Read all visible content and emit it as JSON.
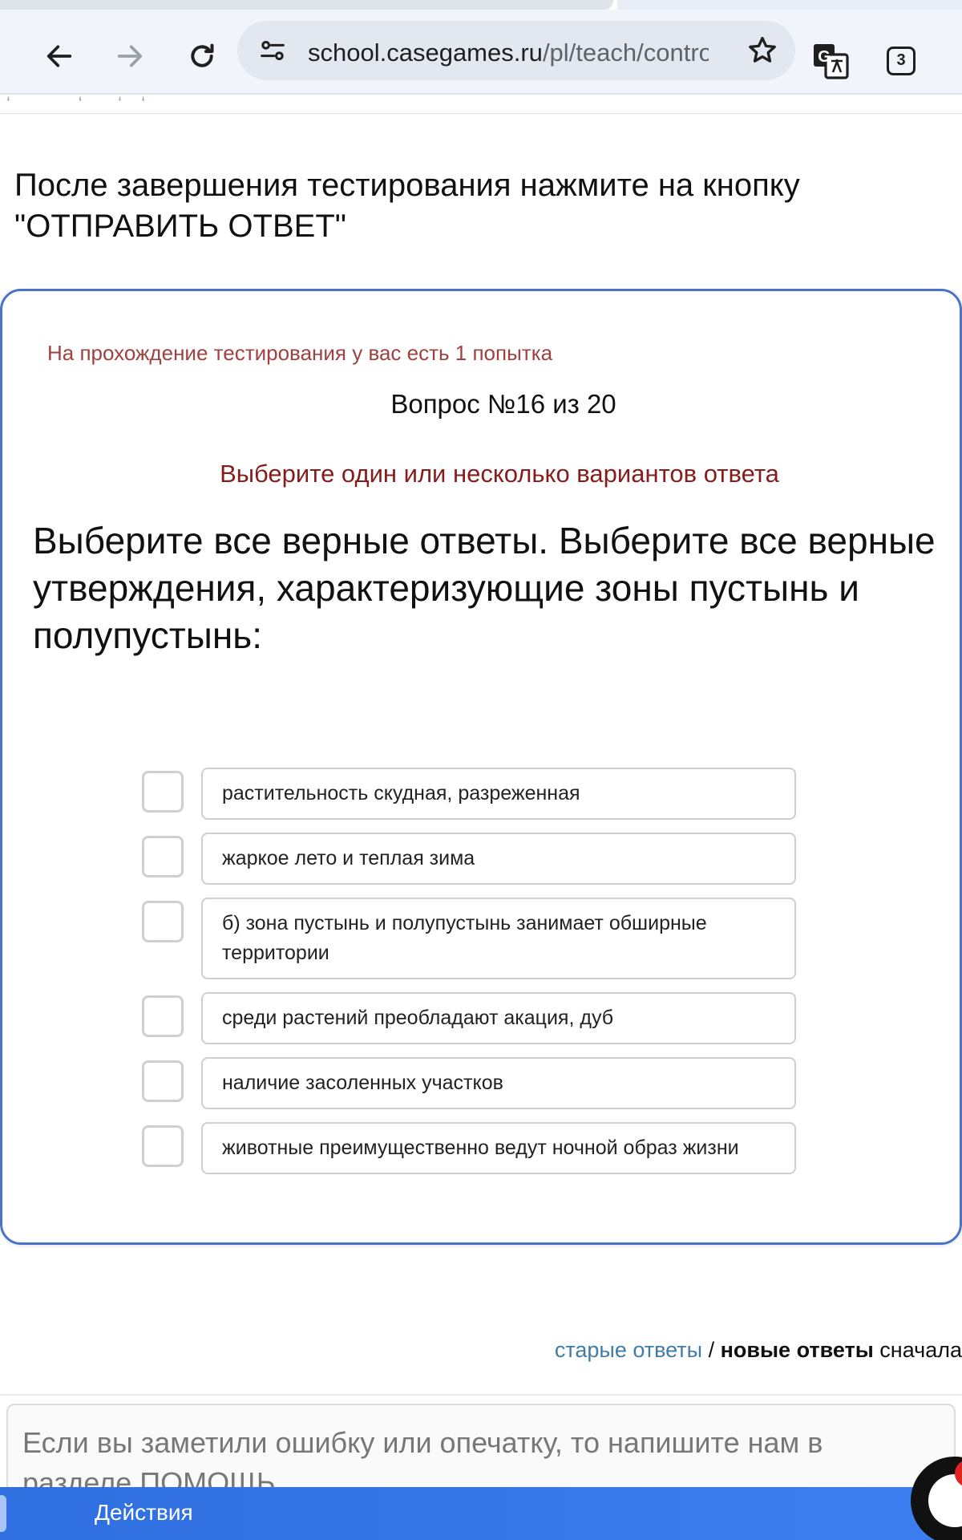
{
  "browser": {
    "url_host": "school.casegames.ru",
    "url_path": "/pl/teach/control",
    "tab_count": "3",
    "icons": [
      "back-icon",
      "forward-icon",
      "reload-icon",
      "site-info-icon",
      "star-icon",
      "translate-icon",
      "tab-switcher-icon"
    ]
  },
  "page": {
    "instruction": "После завершения тестирования нажмите на кнопку \"ОТПРАВИТЬ ОТВЕТ\"",
    "attempts": "На прохождение тестирования у вас есть 1 попытка",
    "question_number": "Вопрос №16 из 20",
    "hint": "Выберите один или несколько вариантов ответа",
    "question": "Выберите все верные ответы. Выберите все верные утверждения, характеризующие зоны пустынь и полупустынь:",
    "answers": [
      {
        "label": "растительность скудная, разреженная",
        "checked": false
      },
      {
        "label": "жаркое лето и теплая зима",
        "checked": false
      },
      {
        "label": "б) зона пустынь и полупустынь занимает обширные территории",
        "checked": false
      },
      {
        "label": "среди растений преобладают акация, дуб",
        "checked": false
      },
      {
        "label": "наличие засоленных участков",
        "checked": false
      },
      {
        "label": "животные преимущественно ведут ночной образ жизни",
        "checked": false
      }
    ]
  },
  "sorting": {
    "old": "старые ответы",
    "separator": " / ",
    "new": "новые ответы",
    "tail": " сначала"
  },
  "feedback": {
    "text": "Если вы заметили ошибку или опечатку, то напишите нам в разделе ПОМОЩЬ"
  },
  "action_bar": {
    "label": "Действия"
  },
  "colors": {
    "card_border": "#4a74c9",
    "attempts_text": "#a0413f",
    "hint_text": "#861c1c",
    "link": "#3f7ca8",
    "action_bar": "#2f6fe0"
  }
}
